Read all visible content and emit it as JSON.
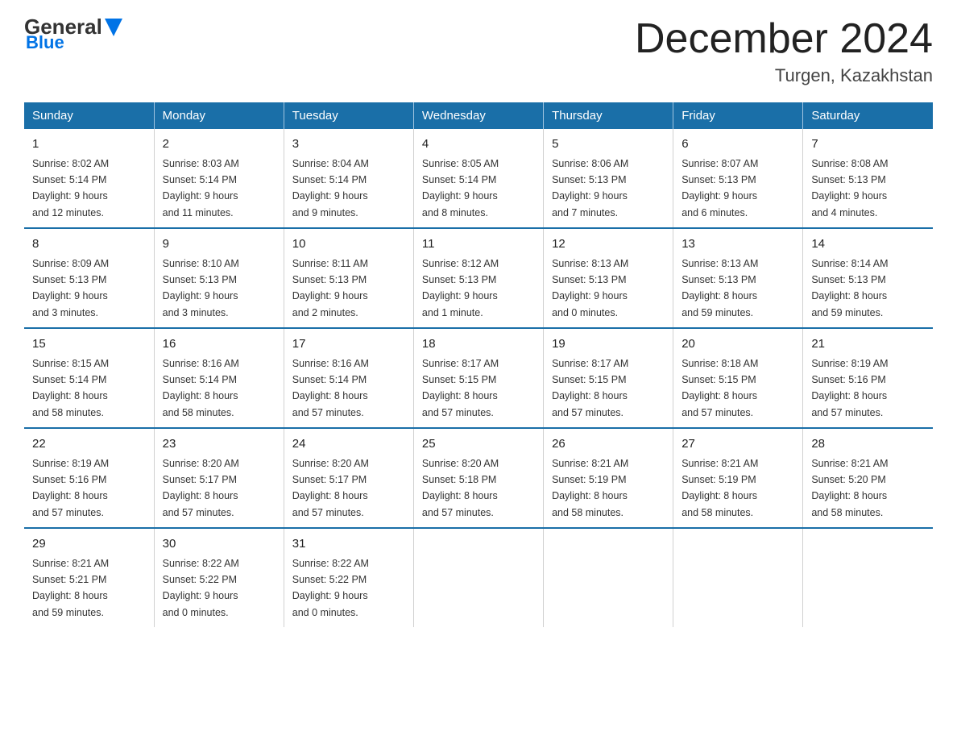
{
  "logo": {
    "general": "General",
    "blue": "Blue"
  },
  "header": {
    "month": "December 2024",
    "location": "Turgen, Kazakhstan"
  },
  "days_of_week": [
    "Sunday",
    "Monday",
    "Tuesday",
    "Wednesday",
    "Thursday",
    "Friday",
    "Saturday"
  ],
  "weeks": [
    [
      {
        "date": "1",
        "sunrise": "8:02 AM",
        "sunset": "5:14 PM",
        "daylight": "9 hours and 12 minutes."
      },
      {
        "date": "2",
        "sunrise": "8:03 AM",
        "sunset": "5:14 PM",
        "daylight": "9 hours and 11 minutes."
      },
      {
        "date": "3",
        "sunrise": "8:04 AM",
        "sunset": "5:14 PM",
        "daylight": "9 hours and 9 minutes."
      },
      {
        "date": "4",
        "sunrise": "8:05 AM",
        "sunset": "5:14 PM",
        "daylight": "9 hours and 8 minutes."
      },
      {
        "date": "5",
        "sunrise": "8:06 AM",
        "sunset": "5:13 PM",
        "daylight": "9 hours and 7 minutes."
      },
      {
        "date": "6",
        "sunrise": "8:07 AM",
        "sunset": "5:13 PM",
        "daylight": "9 hours and 6 minutes."
      },
      {
        "date": "7",
        "sunrise": "8:08 AM",
        "sunset": "5:13 PM",
        "daylight": "9 hours and 4 minutes."
      }
    ],
    [
      {
        "date": "8",
        "sunrise": "8:09 AM",
        "sunset": "5:13 PM",
        "daylight": "9 hours and 3 minutes."
      },
      {
        "date": "9",
        "sunrise": "8:10 AM",
        "sunset": "5:13 PM",
        "daylight": "9 hours and 3 minutes."
      },
      {
        "date": "10",
        "sunrise": "8:11 AM",
        "sunset": "5:13 PM",
        "daylight": "9 hours and 2 minutes."
      },
      {
        "date": "11",
        "sunrise": "8:12 AM",
        "sunset": "5:13 PM",
        "daylight": "9 hours and 1 minute."
      },
      {
        "date": "12",
        "sunrise": "8:13 AM",
        "sunset": "5:13 PM",
        "daylight": "9 hours and 0 minutes."
      },
      {
        "date": "13",
        "sunrise": "8:13 AM",
        "sunset": "5:13 PM",
        "daylight": "8 hours and 59 minutes."
      },
      {
        "date": "14",
        "sunrise": "8:14 AM",
        "sunset": "5:13 PM",
        "daylight": "8 hours and 59 minutes."
      }
    ],
    [
      {
        "date": "15",
        "sunrise": "8:15 AM",
        "sunset": "5:14 PM",
        "daylight": "8 hours and 58 minutes."
      },
      {
        "date": "16",
        "sunrise": "8:16 AM",
        "sunset": "5:14 PM",
        "daylight": "8 hours and 58 minutes."
      },
      {
        "date": "17",
        "sunrise": "8:16 AM",
        "sunset": "5:14 PM",
        "daylight": "8 hours and 57 minutes."
      },
      {
        "date": "18",
        "sunrise": "8:17 AM",
        "sunset": "5:15 PM",
        "daylight": "8 hours and 57 minutes."
      },
      {
        "date": "19",
        "sunrise": "8:17 AM",
        "sunset": "5:15 PM",
        "daylight": "8 hours and 57 minutes."
      },
      {
        "date": "20",
        "sunrise": "8:18 AM",
        "sunset": "5:15 PM",
        "daylight": "8 hours and 57 minutes."
      },
      {
        "date": "21",
        "sunrise": "8:19 AM",
        "sunset": "5:16 PM",
        "daylight": "8 hours and 57 minutes."
      }
    ],
    [
      {
        "date": "22",
        "sunrise": "8:19 AM",
        "sunset": "5:16 PM",
        "daylight": "8 hours and 57 minutes."
      },
      {
        "date": "23",
        "sunrise": "8:20 AM",
        "sunset": "5:17 PM",
        "daylight": "8 hours and 57 minutes."
      },
      {
        "date": "24",
        "sunrise": "8:20 AM",
        "sunset": "5:17 PM",
        "daylight": "8 hours and 57 minutes."
      },
      {
        "date": "25",
        "sunrise": "8:20 AM",
        "sunset": "5:18 PM",
        "daylight": "8 hours and 57 minutes."
      },
      {
        "date": "26",
        "sunrise": "8:21 AM",
        "sunset": "5:19 PM",
        "daylight": "8 hours and 58 minutes."
      },
      {
        "date": "27",
        "sunrise": "8:21 AM",
        "sunset": "5:19 PM",
        "daylight": "8 hours and 58 minutes."
      },
      {
        "date": "28",
        "sunrise": "8:21 AM",
        "sunset": "5:20 PM",
        "daylight": "8 hours and 58 minutes."
      }
    ],
    [
      {
        "date": "29",
        "sunrise": "8:21 AM",
        "sunset": "5:21 PM",
        "daylight": "8 hours and 59 minutes."
      },
      {
        "date": "30",
        "sunrise": "8:22 AM",
        "sunset": "5:22 PM",
        "daylight": "9 hours and 0 minutes."
      },
      {
        "date": "31",
        "sunrise": "8:22 AM",
        "sunset": "5:22 PM",
        "daylight": "9 hours and 0 minutes."
      },
      null,
      null,
      null,
      null
    ]
  ],
  "labels": {
    "sunrise": "Sunrise:",
    "sunset": "Sunset:",
    "daylight": "Daylight:"
  }
}
